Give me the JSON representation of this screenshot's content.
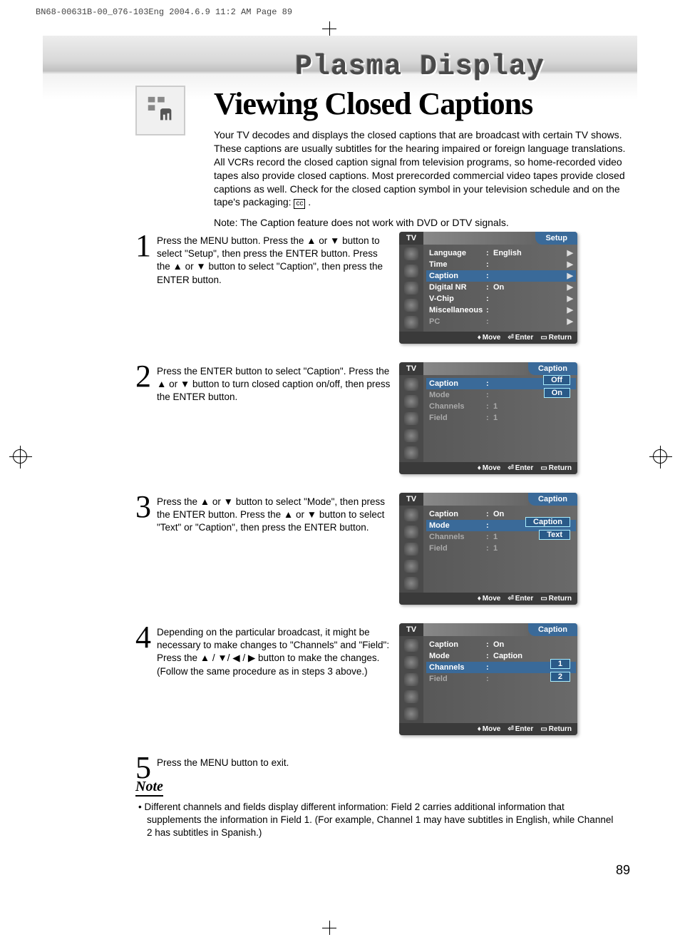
{
  "header": "BN68-00631B-00_076-103Eng  2004.6.9  11:2 AM  Page 89",
  "banner_title": "Plasma Display",
  "page_title": "Viewing Closed Captions",
  "intro": "Your TV decodes and displays the closed captions that are broadcast with certain TV shows. These captions are usually subtitles for the hearing impaired or foreign language translations. All VCRs record the closed caption signal from television programs, so home-recorded video tapes also provide closed captions. Most prerecorded commercial video tapes provide closed captions as well. Check for the closed caption symbol in your television schedule and on the tape's packaging:",
  "cc_symbol": "cc",
  "intro_note": "Note: The Caption feature does not work with DVD or DTV signals.",
  "steps": {
    "s1": {
      "num": "1",
      "text": "Press the MENU button. Press the ▲ or ▼ button to select \"Setup\", then press the ENTER button. Press the ▲ or ▼ button to select \"Caption\", then press the ENTER button."
    },
    "s2": {
      "num": "2",
      "text": "Press the ENTER button to select \"Caption\". Press the ▲ or ▼ button to turn closed caption on/off, then press the ENTER button."
    },
    "s3": {
      "num": "3",
      "text": "Press the ▲ or ▼ button to select \"Mode\", then press the ENTER button. Press the ▲ or ▼ button to select \"Text\" or \"Caption\", then press the ENTER button."
    },
    "s4": {
      "num": "4",
      "text": "Depending on the particular broadcast, it might be necessary to make changes to \"Channels\" and \"Field\": Press the ▲ / ▼/ ◀ / ▶ button to make the changes. (Follow the same procedure as in steps 3 above.)"
    },
    "s5": {
      "num": "5",
      "text": "Press the MENU button to exit."
    }
  },
  "osd": {
    "tv": "TV",
    "foot_move": "Move",
    "foot_enter": "Enter",
    "foot_return": "Return",
    "m1": {
      "title": "Setup",
      "rows": [
        {
          "lab": "Language",
          "val": "English",
          "arr": "▶",
          "hl": false
        },
        {
          "lab": "Time",
          "val": "",
          "arr": "▶",
          "hl": false
        },
        {
          "lab": "Caption",
          "val": "",
          "arr": "▶",
          "hl": true
        },
        {
          "lab": "Digital NR",
          "val": "On",
          "arr": "▶",
          "hl": false
        },
        {
          "lab": "V-Chip",
          "val": "",
          "arr": "▶",
          "hl": false
        },
        {
          "lab": "Miscellaneous",
          "val": "",
          "arr": "▶",
          "hl": false
        },
        {
          "lab": "PC",
          "val": "",
          "arr": "▶",
          "hl": false,
          "dim": true
        }
      ]
    },
    "m2": {
      "title": "Caption",
      "rows": [
        {
          "lab": "Caption",
          "val": "",
          "hl": true
        },
        {
          "lab": "Mode",
          "val": "",
          "dim": true
        },
        {
          "lab": "Channels",
          "val": "1",
          "dim": true
        },
        {
          "lab": "Field",
          "val": "1",
          "dim": true
        }
      ],
      "opts": [
        "Off",
        "On"
      ]
    },
    "m3": {
      "title": "Caption",
      "rows": [
        {
          "lab": "Caption",
          "val": "On"
        },
        {
          "lab": "Mode",
          "val": "",
          "hl": true
        },
        {
          "lab": "Channels",
          "val": "1",
          "dim": true
        },
        {
          "lab": "Field",
          "val": "1",
          "dim": true
        }
      ],
      "opts": [
        "Caption",
        "Text"
      ]
    },
    "m4": {
      "title": "Caption",
      "rows": [
        {
          "lab": "Caption",
          "val": "On"
        },
        {
          "lab": "Mode",
          "val": "Caption"
        },
        {
          "lab": "Channels",
          "val": "",
          "hl": true,
          "dim": false
        },
        {
          "lab": "Field",
          "val": "",
          "dim": true
        }
      ],
      "opts": [
        "1",
        "2"
      ]
    }
  },
  "note": {
    "title": "Note",
    "body": "• Different channels and fields display different information: Field 2 carries additional information that supplements the information in Field 1. (For example, Channel 1 may have subtitles in English, while Channel 2 has subtitles in Spanish.)"
  },
  "page_num": "89"
}
